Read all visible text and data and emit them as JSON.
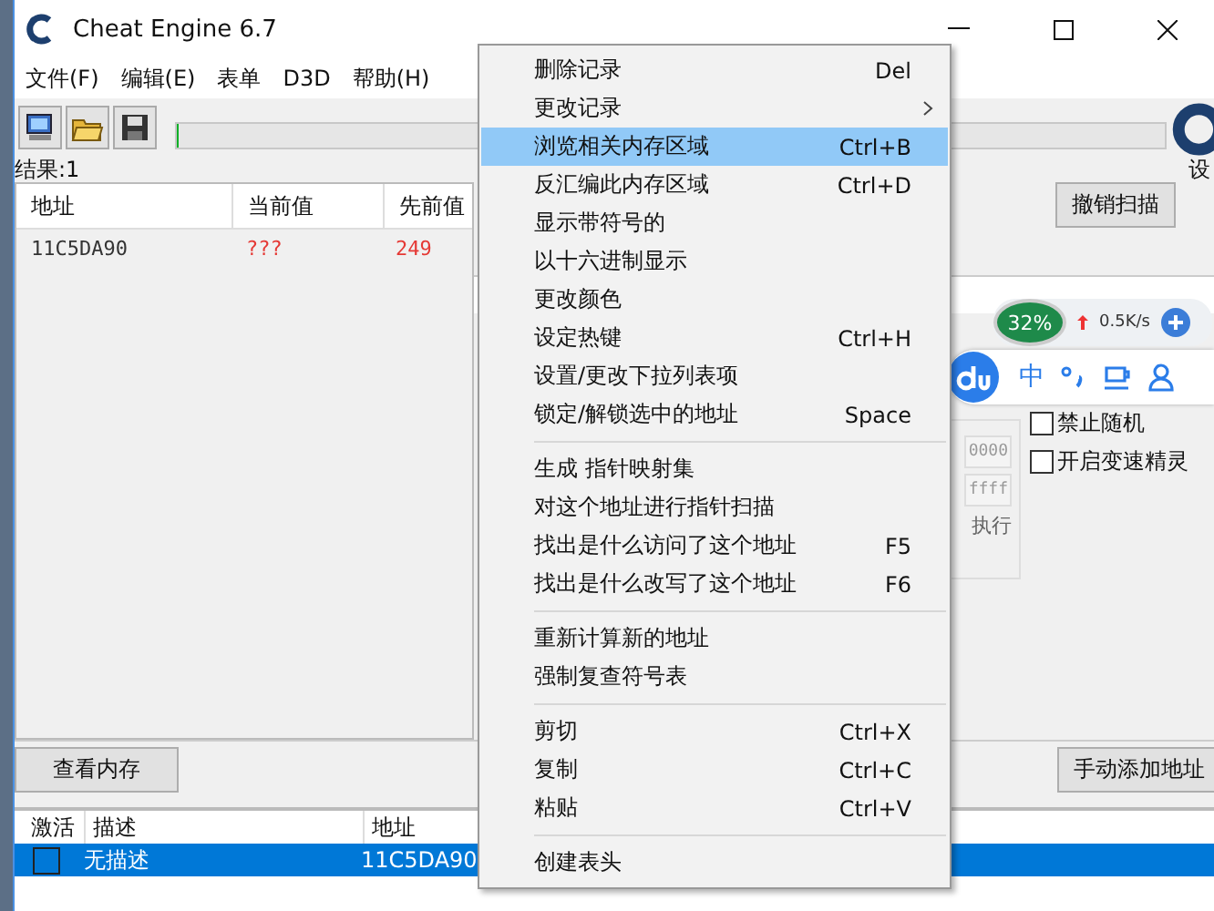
{
  "window": {
    "title": "Cheat Engine 6.7"
  },
  "menu_bar": [
    "文件(F)",
    "编辑(E)",
    "表单",
    "D3D",
    "帮助(H)"
  ],
  "scan_progress": {
    "level": 0
  },
  "results_label": "结果:1",
  "scan_table": {
    "columns": [
      "地址",
      "当前值",
      "先前值"
    ],
    "rows": [
      {
        "address": "11C5DA90",
        "current": "???",
        "previous": "249"
      }
    ]
  },
  "settings_label": "设",
  "undo_scan_button": "撤销扫描",
  "scan_options": {
    "fields": [
      "0000",
      "ffff"
    ],
    "executable_label": "执行",
    "checkboxes": [
      {
        "label": "禁止随机",
        "checked": false
      },
      {
        "label": "开启变速精灵",
        "checked": false
      }
    ]
  },
  "memory_view_button": "查看内存",
  "add_address_button": "手动添加地址",
  "address_list": {
    "columns": [
      "激活",
      "描述",
      "地址"
    ],
    "rows": [
      {
        "active": false,
        "description": "无描述",
        "address": "11C5DA90",
        "selected": true
      }
    ]
  },
  "monitor_widget": {
    "cpu": "32%",
    "speed": "0.5K/s"
  },
  "ime_bar": {
    "mode": "中"
  },
  "context_menu": {
    "groups": [
      {
        "items": [
          {
            "label": "删除记录",
            "shortcut": "Del",
            "submenu": false,
            "selected": false
          },
          {
            "label": "更改记录",
            "submenu": true,
            "selected": false
          },
          {
            "label": "浏览相关内存区域",
            "shortcut": "Ctrl+B",
            "submenu": false,
            "selected": true
          },
          {
            "label": "反汇编此内存区域",
            "shortcut": "Ctrl+D",
            "submenu": false,
            "selected": false
          },
          {
            "label": "显示带符号的",
            "submenu": false,
            "selected": false
          },
          {
            "label": "以十六进制显示",
            "submenu": false,
            "selected": false
          },
          {
            "label": "更改颜色",
            "submenu": false,
            "selected": false
          },
          {
            "label": "设定热键",
            "shortcut": "Ctrl+H",
            "submenu": false,
            "selected": false
          },
          {
            "label": "设置/更改下拉列表项",
            "submenu": false,
            "selected": false
          },
          {
            "label": "锁定/解锁选中的地址",
            "shortcut": "Space",
            "submenu": false,
            "selected": false
          }
        ]
      },
      {
        "items": [
          {
            "label": "生成 指针映射集",
            "submenu": false,
            "selected": false
          },
          {
            "label": "对这个地址进行指针扫描",
            "submenu": false,
            "selected": false
          },
          {
            "label": "找出是什么访问了这个地址",
            "shortcut": "F5",
            "submenu": false,
            "selected": false
          },
          {
            "label": "找出是什么改写了这个地址",
            "shortcut": "F6",
            "submenu": false,
            "selected": false
          }
        ]
      },
      {
        "items": [
          {
            "label": "重新计算新的地址",
            "submenu": false,
            "selected": false
          },
          {
            "label": "强制复查符号表",
            "submenu": false,
            "selected": false
          }
        ]
      },
      {
        "items": [
          {
            "label": "剪切",
            "shortcut": "Ctrl+X",
            "submenu": false,
            "selected": false
          },
          {
            "label": "复制",
            "shortcut": "Ctrl+C",
            "submenu": false,
            "selected": false
          },
          {
            "label": "粘贴",
            "shortcut": "Ctrl+V",
            "submenu": false,
            "selected": false
          }
        ]
      },
      {
        "items": [
          {
            "label": "创建表头",
            "submenu": false,
            "selected": false
          }
        ]
      }
    ]
  }
}
